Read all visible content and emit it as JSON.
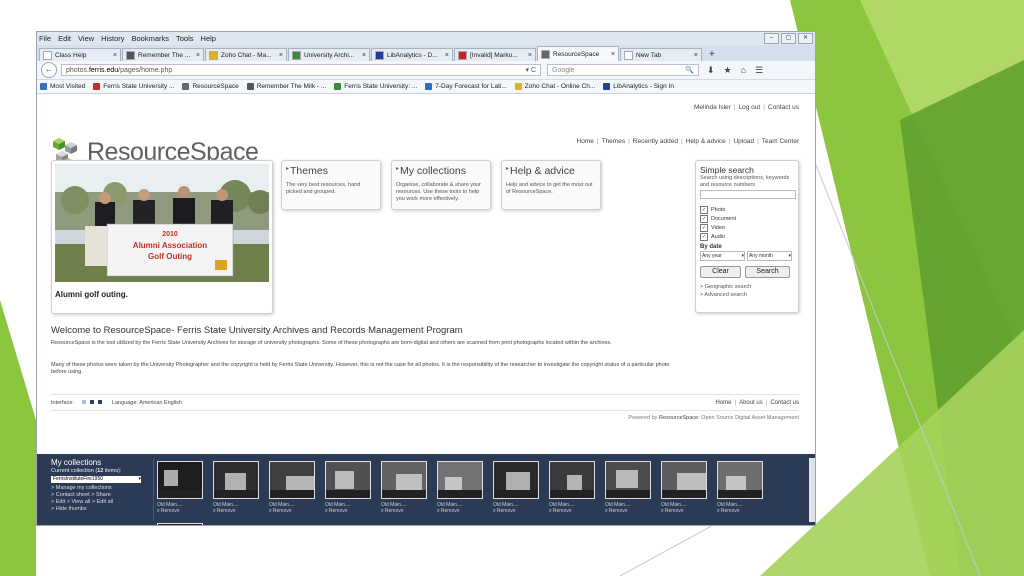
{
  "browser": {
    "menu": [
      "File",
      "Edit",
      "View",
      "History",
      "Bookmarks",
      "Tools",
      "Help"
    ],
    "window_controls": [
      "–",
      "▢",
      "✕"
    ],
    "tabs": [
      {
        "label": "Class Help",
        "active": false,
        "color": "#ffffff"
      },
      {
        "label": "Remember The ...",
        "active": false,
        "color": "#555555"
      },
      {
        "label": "Zoho Chat - Ma...",
        "active": false,
        "color": "#e0b020"
      },
      {
        "label": "University Archi...",
        "active": false,
        "color": "#3a8a3a"
      },
      {
        "label": "LibAnalytics - D...",
        "active": false,
        "color": "#1f3f9f"
      },
      {
        "label": "[Invalid] Marku...",
        "active": false,
        "color": "#cc2222"
      },
      {
        "label": "ResourceSpace",
        "active": true,
        "color": "#666666"
      },
      {
        "label": "New Tab",
        "active": false,
        "color": "#ffffff"
      }
    ],
    "new_tab_label": "+",
    "url_prefix": "photos.",
    "url_domain": "ferris.edu",
    "url_path": "/pages/home.php",
    "url_icons": "▾ C",
    "search_placeholder": "Google",
    "search_icon": "🔍",
    "nav_icons": [
      "⬇",
      "★",
      "⌂",
      "☰"
    ],
    "back_icon": "←",
    "bookmarks": [
      {
        "label": "Most Visited",
        "color": "#3a6fb0"
      },
      {
        "label": "Ferris State University ...",
        "color": "#c0302a"
      },
      {
        "label": "ResourceSpace",
        "color": "#666666"
      },
      {
        "label": "Remember The Milk - ...",
        "color": "#555555"
      },
      {
        "label": "Ferris State University: ...",
        "color": "#3a8a3a"
      },
      {
        "label": "7-Day Forecast for Lati...",
        "color": "#2a6fc0"
      },
      {
        "label": "Zoho Chat - Online Ch...",
        "color": "#e0b020"
      },
      {
        "label": "LibAnalytics - Sign In",
        "color": "#1f3f9f"
      }
    ]
  },
  "site": {
    "logo_text": "ResourceSpace",
    "user_links": [
      "Melinda Isler",
      "Log out",
      "Contact us"
    ],
    "nav": [
      "Home",
      "Themes",
      "Recently added",
      "Help & advice",
      "Upload",
      "Team Center"
    ],
    "featured_caption": "Alumni golf outing.",
    "banner_year": "2010",
    "banner_line1": "Alumni Association",
    "banner_line2": "Golf Outing",
    "panels": [
      {
        "title": "Themes",
        "text": "The very best resources, hand picked and grouped."
      },
      {
        "title": "My collections",
        "text": "Organise, collaborate & share your resources. Use these tools to help you work more effectively."
      },
      {
        "title": "Help & advice",
        "text": "Help and advice to get the most out of ResourceSpace."
      }
    ],
    "search": {
      "title": "Simple search",
      "desc": "Search using descriptions, keywords and resource numbers",
      "types": [
        "Photo",
        "Document",
        "Video",
        "Audio"
      ],
      "check_mark": "✓",
      "by_date": "By date",
      "year": "Any year",
      "month": "Any month",
      "clear": "Clear",
      "search": "Search",
      "links": [
        "> Geographic search",
        "> Advanced search"
      ]
    },
    "welcome_title": "Welcome to ResourceSpace- Ferris State University Archives and Records Management Program",
    "para1": "ResourceSpace is the tool utilized by the Ferris State University Archives for storage of university photographs. Some of these photographs are born-digital and others are scanned from print photographs located within the archives.",
    "para2": "Many of these photos were taken by the University Photographer and the copyright is held by Ferris State University. However, this is not the case for all photos. It is the responsibility of the researcher to investigate the copyright status of a particular photo before using.",
    "interface_label": "Interface:",
    "language_label": "Language: American English",
    "footer_links": [
      "Home",
      "About us",
      "Contact us"
    ],
    "powered_prefix": "Powered by",
    "powered_brand": "ResourceSpace",
    "powered_suffix": ": Open Source Digital Asset Management"
  },
  "collections": {
    "title": "My collections",
    "current_prefix": "Current collection (",
    "count": "12",
    "current_suffix": " items):",
    "selected": "FerrisInstituteFire1950",
    "links": [
      "> Manage my collections",
      "> Contact sheet  > Share",
      "> Edit  > View all  > Edit all",
      "> Hide thumbs"
    ],
    "thumb_title": "Old Main....",
    "thumb_remove": "x Remove"
  }
}
